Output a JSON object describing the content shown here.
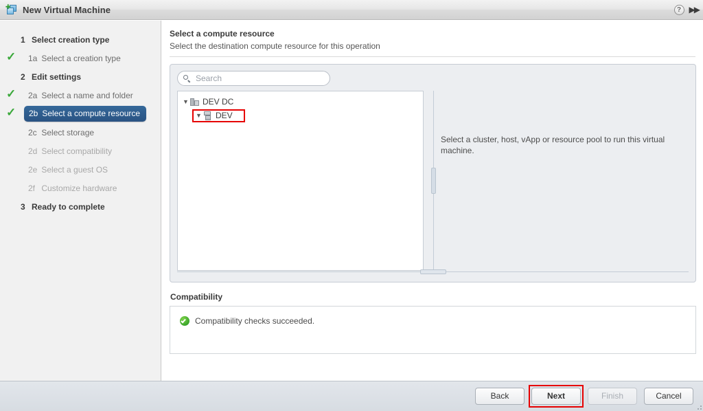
{
  "window": {
    "title": "New Virtual Machine",
    "app_icon": "new-virtual-machine-icon",
    "help_label": "?",
    "collapse_label": "▶▶"
  },
  "sidebar": {
    "items": [
      {
        "num": "1",
        "label": "Select creation type",
        "style": "group",
        "checked": false
      },
      {
        "num": "1a",
        "label": "Select a creation type",
        "style": "sub",
        "checked": true
      },
      {
        "num": "2",
        "label": "Edit settings",
        "style": "group",
        "checked": false
      },
      {
        "num": "2a",
        "label": "Select a name and folder",
        "style": "sub",
        "checked": true
      },
      {
        "num": "2b",
        "label": "Select a compute resource",
        "style": "selected",
        "checked": true
      },
      {
        "num": "2c",
        "label": "Select storage",
        "style": "sub",
        "checked": false
      },
      {
        "num": "2d",
        "label": "Select compatibility",
        "style": "muted",
        "checked": false
      },
      {
        "num": "2e",
        "label": "Select a guest OS",
        "style": "muted",
        "checked": false
      },
      {
        "num": "2f",
        "label": "Customize hardware",
        "style": "muted",
        "checked": false
      },
      {
        "num": "3",
        "label": "Ready to complete",
        "style": "group",
        "checked": false
      }
    ]
  },
  "main": {
    "title": "Select a compute resource",
    "subtitle": "Select the destination compute resource for this operation",
    "search": {
      "placeholder": "Search",
      "value": "",
      "icon": "search-icon"
    },
    "tree": [
      {
        "label": "DEV DC",
        "icon": "datacenter-icon",
        "level": 1,
        "expanded": true,
        "highlighted": false
      },
      {
        "label": "DEV",
        "icon": "cluster-icon",
        "level": 2,
        "expanded": true,
        "highlighted": true
      }
    ],
    "description": "Select a cluster, host, vApp or resource pool to run this virtual machine.",
    "compatibility": {
      "heading": "Compatibility",
      "status_icon": "success-check-icon",
      "status_text": "Compatibility checks succeeded."
    }
  },
  "footer": {
    "buttons": [
      {
        "label": "Back",
        "disabled": false,
        "highlighted": false
      },
      {
        "label": "Next",
        "disabled": false,
        "highlighted": true
      },
      {
        "label": "Finish",
        "disabled": true,
        "highlighted": false
      },
      {
        "label": "Cancel",
        "disabled": false,
        "highlighted": false
      }
    ]
  },
  "colors": {
    "selected_nav": "#2e5d8e",
    "check_green": "#3aa83a",
    "annotation_red": "#e60000",
    "success_green": "#3aa62b"
  }
}
